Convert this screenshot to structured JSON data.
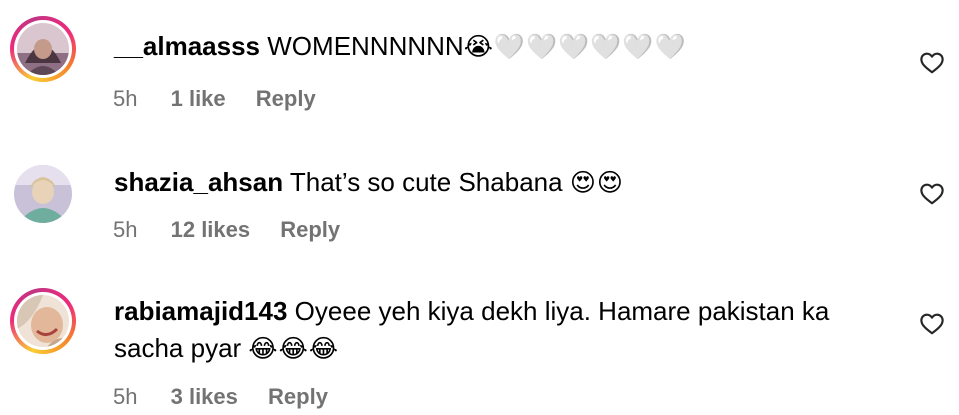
{
  "comments": [
    {
      "username": "__almaasss",
      "text": "WOMENNNNNN",
      "emoji": "😭🤍🤍🤍🤍🤍🤍",
      "time": "5h",
      "likes": "1 like",
      "reply": "Reply"
    },
    {
      "username": "shazia_ahsan",
      "text": "That’s so cute Shabana",
      "emoji": "😍😍",
      "time": "5h",
      "likes": "12 likes",
      "reply": "Reply"
    },
    {
      "username": "rabiamajid143",
      "text": "Oyeee yeh kiya dekh liya. Hamare pakistan ka",
      "text_line2": "sacha pyar",
      "emoji": "😂😂😂",
      "time": "5h",
      "likes": "3 likes",
      "reply": "Reply"
    }
  ],
  "icons": {
    "like": "heart-outline-icon"
  },
  "colors": {
    "meta_text": "#737373",
    "story_ring": "#ee2a7b"
  }
}
